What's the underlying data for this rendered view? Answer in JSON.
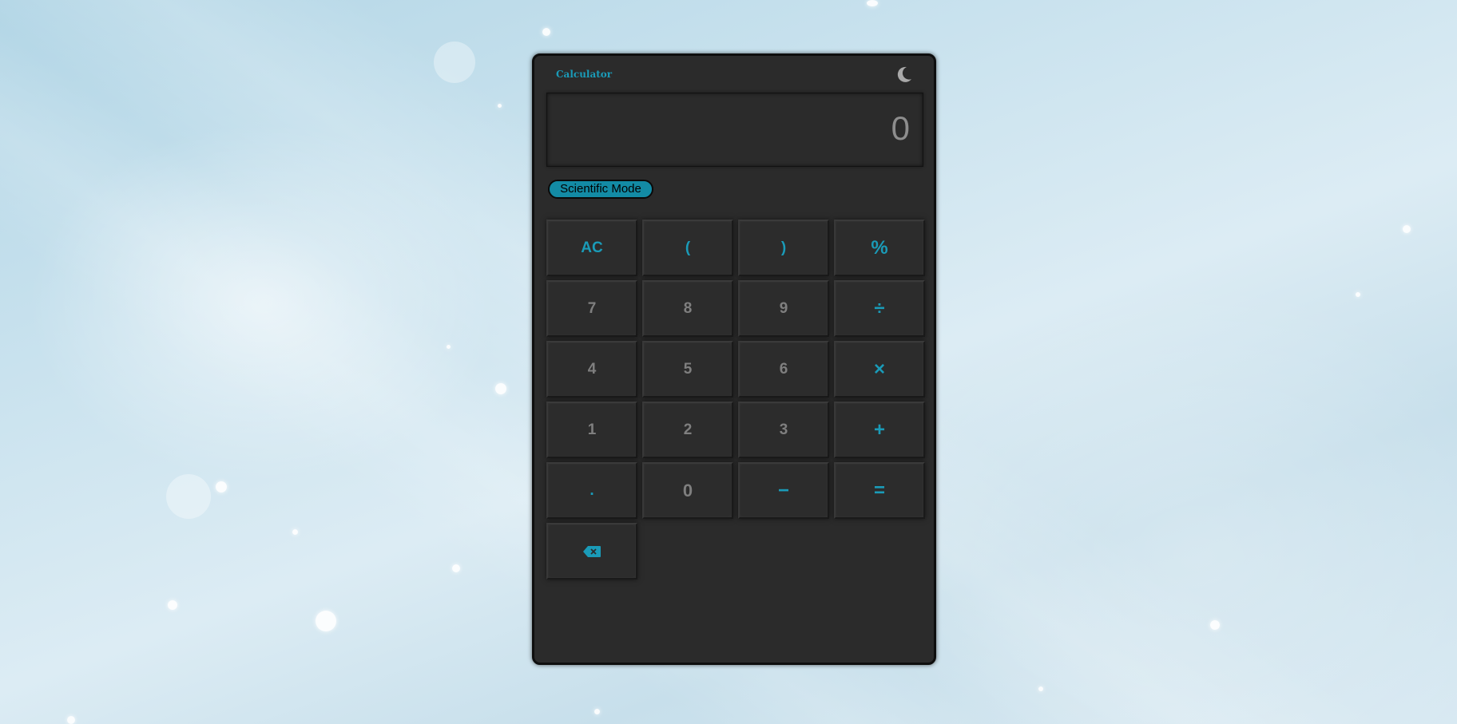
{
  "app": {
    "title": "Calculator"
  },
  "theme_toggle": {
    "icon": "moon-icon"
  },
  "display": {
    "value": "0"
  },
  "mode_button": {
    "label": "Scientific Mode"
  },
  "colors": {
    "accent": "#1a9bb8",
    "panel": "#2b2b2b",
    "number_text": "#7f7f7f"
  },
  "keys": {
    "ac": "AC",
    "open_paren": "(",
    "close_paren": ")",
    "percent": "%",
    "seven": "7",
    "eight": "8",
    "nine": "9",
    "divide": "÷",
    "four": "4",
    "five": "5",
    "six": "6",
    "multiply": "×",
    "one": "1",
    "two": "2",
    "three": "3",
    "plus": "+",
    "decimal": ".",
    "zero": "0",
    "minus": "−",
    "equals": "=",
    "backspace": "backspace-icon"
  }
}
